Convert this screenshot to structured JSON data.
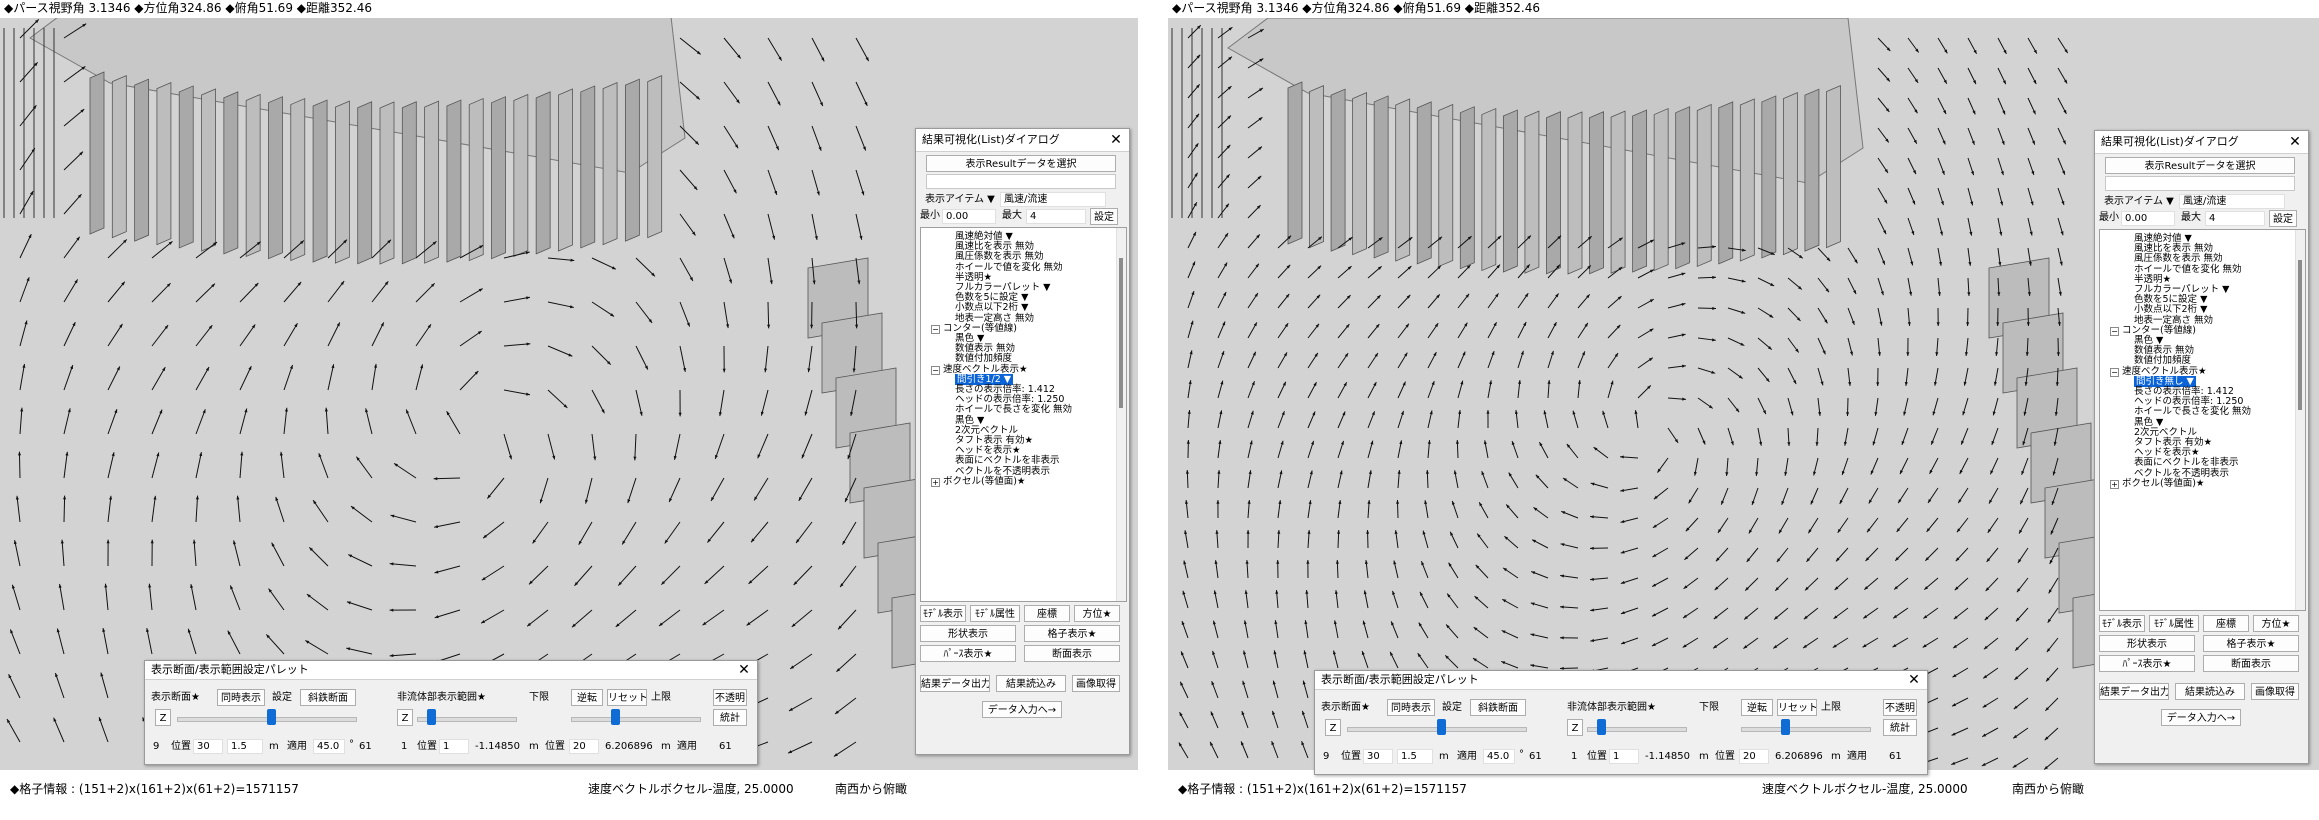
{
  "left": {
    "info": {
      "fov_label": "◆パース視野角",
      "fov": "3.1346",
      "azimuth_label": "◆方位角",
      "azimuth": "324.86",
      "elevation_label": "◆俯角",
      "elevation": "51.69",
      "distance_label": "◆距離",
      "distance": "352.46"
    },
    "status": {
      "grid": "◆格子情報 : (151+2)x(161+2)x(61+2)=1571157",
      "vector": "速度ベクトルボクセル-温度, 25.0000",
      "view": "南西から俯瞰"
    }
  },
  "right": {
    "info": {
      "fov_label": "◆パース視野角",
      "fov": "3.1346",
      "azimuth_label": "◆方位角",
      "azimuth": "324.86",
      "elevation_label": "◆俯角",
      "elevation": "51.69",
      "distance_label": "◆距離",
      "distance": "352.46"
    },
    "status": {
      "grid": "◆格子情報 : (151+2)x(161+2)x(61+2)=1571157",
      "vector": "速度ベクトルボクセル-温度, 25.0000",
      "view": "南西から俯瞰"
    }
  },
  "dialog": {
    "title": "結果可視化(List)ダイアログ",
    "select_result": "表示Resultデータを選択",
    "item_label": "表示アイテム ▼",
    "item_value": "風速/流速",
    "min_label": "最小",
    "min_value": "0.00",
    "max_label": "最大",
    "max_value": "4",
    "set_button": "設定",
    "tree_left": [
      "風速絶対値 ▼",
      "風速比を表示 無効",
      "風圧係数を表示 無効",
      "ホイールで値を変化 無効",
      "半透明★",
      "フルカラーパレット ▼",
      "色数を5に設定 ▼",
      "小数点以下2桁 ▼",
      "地表一定高さ 無効",
      "コンター(等値線)",
      "黒色 ▼",
      "数値表示  無効",
      "数値付加頻度",
      "速度ベクトル表示★",
      "間引き1/2 ▼",
      "長さの表示倍率: 1.412",
      "ヘッドの表示倍率: 1.250",
      "ホイールで長さを変化 無効",
      "黒色 ▼",
      "2次元ベクトル",
      "タフト表示 有効★",
      "ヘッドを表示★",
      "表面にベクトルを非表示",
      "ベクトルを不透明表示",
      "ボクセル(等値面)★"
    ],
    "tree_right": [
      "風速絶対値 ▼",
      "風速比を表示 無効",
      "風圧係数を表示 無効",
      "ホイールで値を変化 無効",
      "半透明★",
      "フルカラーパレット ▼",
      "色数を5に設定 ▼",
      "小数点以下2桁 ▼",
      "地表一定高さ 無効",
      "コンター(等値線)",
      "黒色 ▼",
      "数値表示  無効",
      "数値付加頻度",
      "速度ベクトル表示★",
      "間引き無し ▼",
      "長さの表示倍率: 1.412",
      "ヘッドの表示倍率: 1.250",
      "ホイールで長さを変化 無効",
      "黒色 ▼",
      "2次元ベクトル",
      "タフト表示 有効★",
      "ヘッドを表示★",
      "表面にベクトルを非表示",
      "ベクトルを不透明表示",
      "ボクセル(等値面)★"
    ],
    "model_display": "ﾓﾃﾞﾙ表示",
    "model_attr": "ﾓﾃﾞﾙ属性",
    "coord": "座標",
    "bearing": "方位★",
    "shape_display": "形状表示",
    "grid_display": "格子表示★",
    "perspective": "ﾊﾟｰｽ表示★",
    "section_display": "断面表示",
    "result_output": "結果データ出力",
    "result_load": "結果読込み",
    "capture": "画像取得",
    "data_input": "データ入力へ→"
  },
  "palette": {
    "title": "表示断面/表示範囲設定パレット",
    "section_label": "表示断面★",
    "simul": "同時表示",
    "setting": "設定",
    "oblique": "斜鉄断面",
    "axis": "Z",
    "nonflow_label": "非流体部表示範囲★",
    "lower": "下限",
    "reverse": "逆転",
    "reset": "リセット",
    "upper": "上限",
    "opaque": "不透明",
    "stats": "統計",
    "s1_index": "9",
    "s1_pos_label": "位置",
    "s1_pos": "30",
    "s1_step": "1.5",
    "s1_unit": "m",
    "s1_apply": "適用",
    "s1_angle": "45.0",
    "s1_deg": "°",
    "s1_n": "61",
    "s2_index": "1",
    "s2_pos_label": "位置",
    "s2_pos": "1",
    "s2_val": "-1.14850",
    "s2_unit": "m",
    "s3_pos_label": "位置",
    "s3_pos": "20",
    "s3_val": "6.206896",
    "s3_unit": "m",
    "s3_apply": "適用",
    "s3_n": "61"
  }
}
